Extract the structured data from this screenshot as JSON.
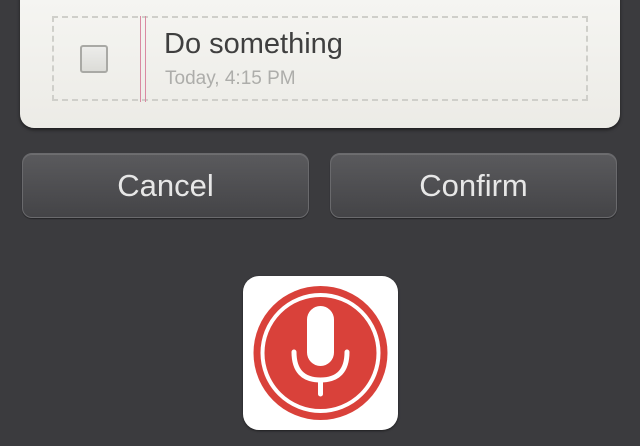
{
  "task": {
    "title": "Do something",
    "time": "Today, 4:15 PM",
    "checked": false
  },
  "buttons": {
    "cancel_label": "Cancel",
    "confirm_label": "Confirm"
  },
  "mic": {
    "icon": "microphone-icon",
    "accent_color": "#d9413a"
  },
  "colors": {
    "background": "#3b3b3e",
    "card": "#f2f1ed",
    "margin_line": "#d98aa2"
  }
}
